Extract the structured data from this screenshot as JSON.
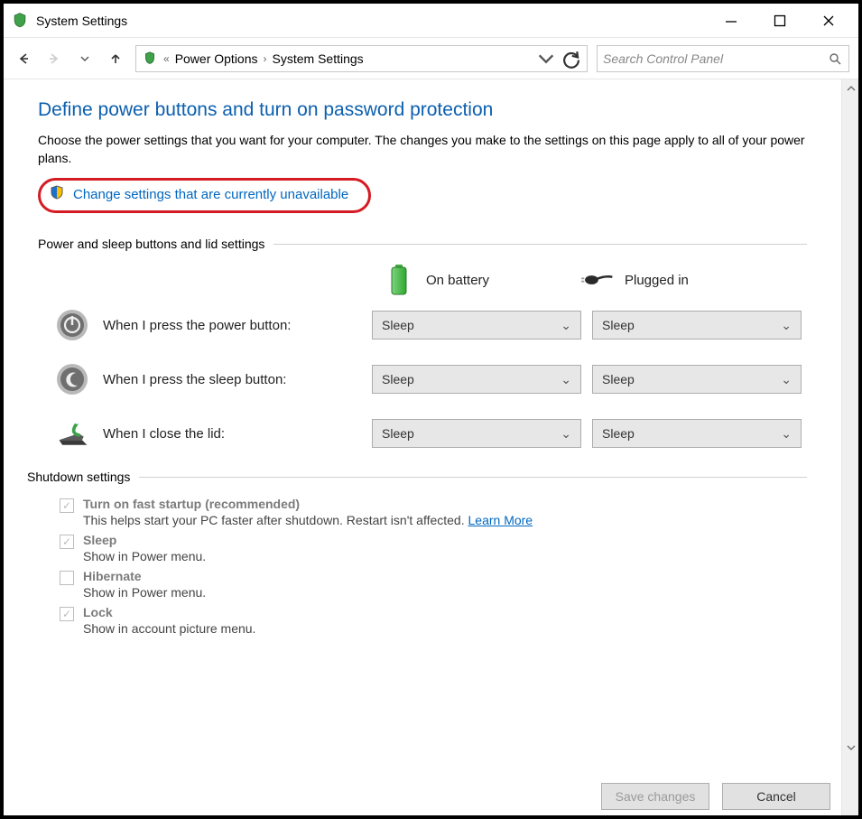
{
  "window": {
    "title": "System Settings"
  },
  "breadcrumb": {
    "segments": [
      "Power Options",
      "System Settings"
    ]
  },
  "search": {
    "placeholder": "Search Control Panel"
  },
  "main": {
    "title": "Define power buttons and turn on password protection",
    "description": "Choose the power settings that you want for your computer. The changes you make to the settings on this page apply to all of your power plans.",
    "uac_link": "Change settings that are currently unavailable"
  },
  "sections": {
    "power_sleep": {
      "heading": "Power and sleep buttons and lid settings",
      "col_battery": "On battery",
      "col_plugged": "Plugged in",
      "rows": [
        {
          "label": "When I press the power button:",
          "battery": "Sleep",
          "plugged": "Sleep"
        },
        {
          "label": "When I press the sleep button:",
          "battery": "Sleep",
          "plugged": "Sleep"
        },
        {
          "label": "When I close the lid:",
          "battery": "Sleep",
          "plugged": "Sleep"
        }
      ]
    },
    "shutdown": {
      "heading": "Shutdown settings",
      "items": [
        {
          "label": "Turn on fast startup (recommended)",
          "sub": "This helps start your PC faster after shutdown. Restart isn't affected. ",
          "link": "Learn More",
          "checked": true
        },
        {
          "label": "Sleep",
          "sub": "Show in Power menu.",
          "checked": true
        },
        {
          "label": "Hibernate",
          "sub": "Show in Power menu.",
          "checked": false
        },
        {
          "label": "Lock",
          "sub": "Show in account picture menu.",
          "checked": true
        }
      ]
    }
  },
  "footer": {
    "save": "Save changes",
    "cancel": "Cancel"
  }
}
